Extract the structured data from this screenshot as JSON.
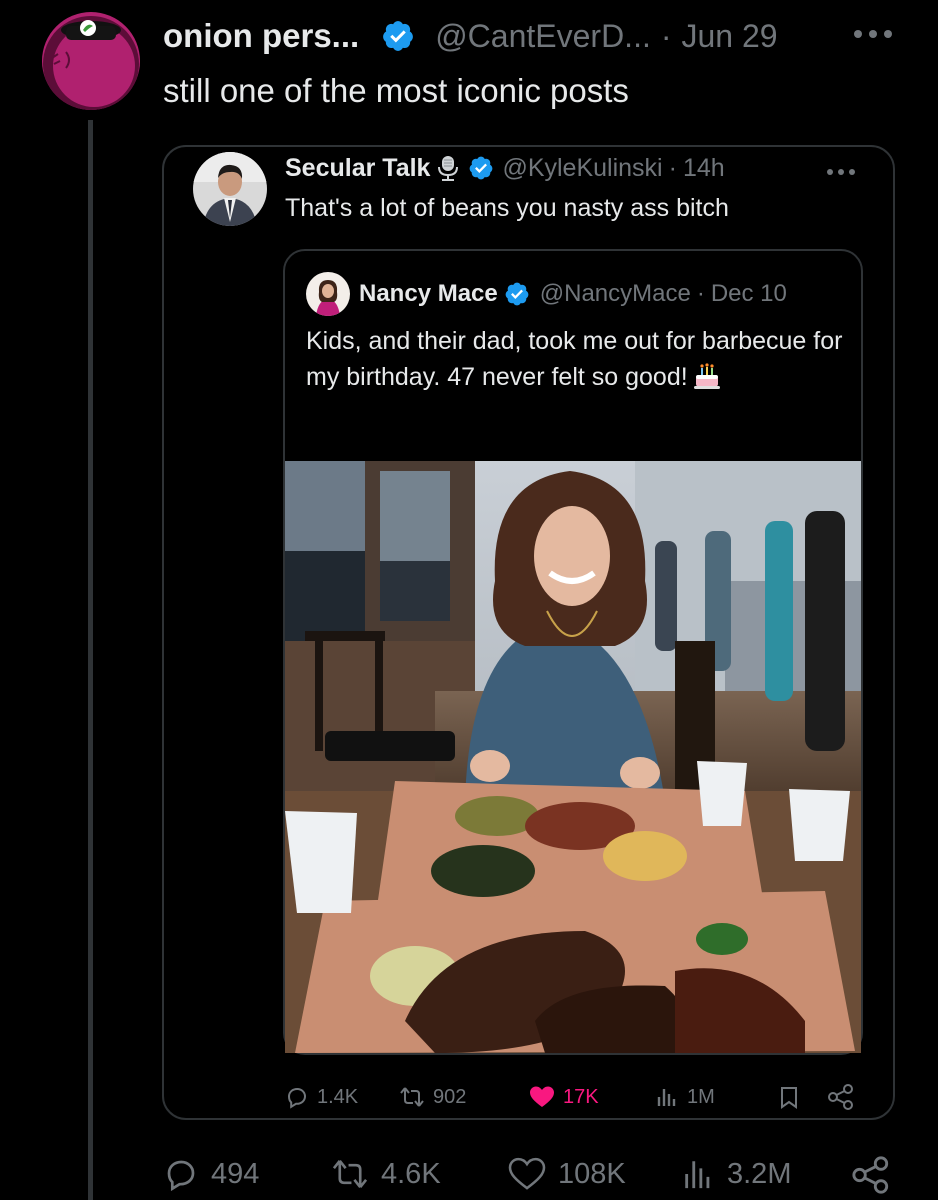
{
  "post": {
    "author_name": "onion pers...",
    "handle": "@CantEverD...",
    "separator": "·",
    "date": "Jun 29",
    "text": "still one of the most iconic posts",
    "stats": {
      "replies": "494",
      "reposts": "4.6K",
      "likes": "108K",
      "views": "3.2M"
    }
  },
  "quote": {
    "author_name": "Secular Talk",
    "handle": "@KyleKulinski",
    "separator": "·",
    "date": "14h",
    "text": "That's a lot of beans you nasty ass bitch",
    "stats": {
      "replies": "1.4K",
      "reposts": "902",
      "likes": "17K",
      "views": "1M"
    }
  },
  "nested_quote": {
    "author_name": "Nancy Mace",
    "handle": "@NancyMace",
    "separator": "·",
    "date": "Dec 10",
    "text": "Kids, and their dad, took me out for barbecue for my birthday. 47 never felt so good!"
  },
  "colors": {
    "background": "#000000",
    "text": "#e7e9ea",
    "muted": "#71767b",
    "verified": "#1d9bf0",
    "like": "#f91880",
    "border": "#2f3336"
  },
  "icons": [
    "onion-avatar",
    "verified-badge",
    "more-icon",
    "microphone-icon",
    "birthday-cake-emoji",
    "reply-icon",
    "repost-icon",
    "heart-icon",
    "views-icon",
    "bookmark-icon",
    "share-icon"
  ]
}
